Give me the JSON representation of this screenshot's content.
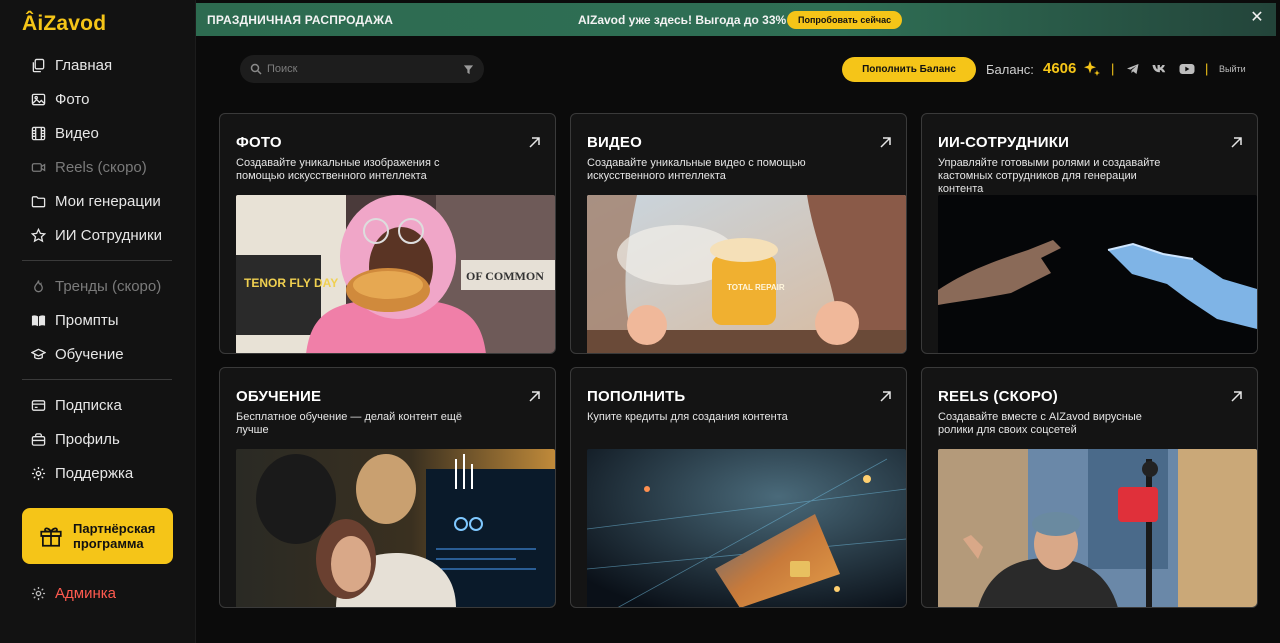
{
  "logo": "ÂiZavod",
  "sidebar": {
    "group1": [
      {
        "label": "Главная",
        "icon": "copy-icon",
        "dim": false
      },
      {
        "label": "Фото",
        "icon": "image-icon",
        "dim": false
      },
      {
        "label": "Видео",
        "icon": "film-icon",
        "dim": false
      },
      {
        "label": "Reels (скоро)",
        "icon": "camera-icon",
        "dim": true
      },
      {
        "label": "Мои генерации",
        "icon": "folder-icon",
        "dim": false
      },
      {
        "label": "ИИ Сотрудники",
        "icon": "star-icon",
        "dim": false
      }
    ],
    "group2": [
      {
        "label": "Тренды (скоро)",
        "icon": "flame-icon",
        "dim": true
      },
      {
        "label": "Промпты",
        "icon": "book-icon",
        "dim": false
      },
      {
        "label": "Обучение",
        "icon": "graduation-cap-icon",
        "dim": false
      }
    ],
    "group3": [
      {
        "label": "Подписка",
        "icon": "card-icon",
        "dim": false
      },
      {
        "label": "Профиль",
        "icon": "user-icon",
        "dim": false
      },
      {
        "label": "Поддержка",
        "icon": "gear-icon",
        "dim": false
      }
    ],
    "partner_label": "Партнёрская программа",
    "admin_label": "Админка"
  },
  "banner": {
    "left": "ПРАЗДНИЧНАЯ РАСПРОДАЖА",
    "middle": "AIZavod уже здесь! Выгода до 33%",
    "button": "Попробовать сейчас",
    "close": "✕"
  },
  "topbar": {
    "search_placeholder": "Поиск",
    "topup_button": "Пополнить Баланс",
    "balance_label": "Баланс:",
    "balance_value": "4606",
    "separator": "|",
    "logout": "Выйти"
  },
  "cards": [
    {
      "title": "ФОТО",
      "desc": "Создавайте уникальные изображения с помощью искусственного интеллекта"
    },
    {
      "title": "ВИДЕО",
      "desc": "Создавайте уникальные видео с помощью искусственного интеллекта"
    },
    {
      "title": "ИИ-СОТРУДНИКИ",
      "desc": "Управляйте готовыми ролями и создавайте кастомных сотрудников для генерации контента"
    },
    {
      "title": "ОБУЧЕНИЕ",
      "desc": "Бесплатное обучение — делай контент ещё лучше"
    },
    {
      "title": "ПОПОЛНИТЬ",
      "desc": "Купите кредиты для создания контента"
    },
    {
      "title": "REELS (СКОРО)",
      "desc": "Создавайте вместе с AIZavod вирусные ролики для своих соцсетей"
    }
  ],
  "image_texts": {
    "poster_left": "TENOR FLY DAY",
    "poster_right": "OF COMMON",
    "jar_label": "TOTAL REPAIR"
  },
  "colors": {
    "accent": "#f5c518",
    "banner": "#2f6f55",
    "danger": "#ff5a4f",
    "background": "#0b0b0b"
  }
}
